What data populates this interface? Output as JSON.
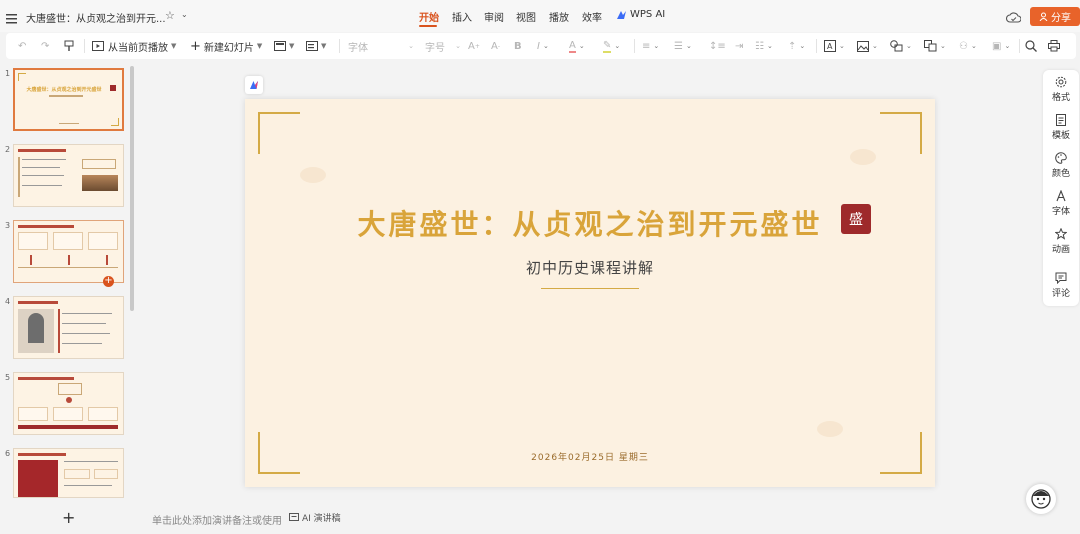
{
  "app": {
    "doc_title": "大唐盛世：从贞观之治到开元...",
    "share_label": "分享"
  },
  "menu": {
    "tabs": [
      "开始",
      "插入",
      "审阅",
      "视图",
      "播放",
      "效率",
      "WPS AI"
    ],
    "active": "开始"
  },
  "toolbar": {
    "play_from_current": "从当前页播放",
    "new_slide": "新建幻灯片",
    "font_placeholder": "字体",
    "size_placeholder": "字号"
  },
  "thumbnails": [
    {
      "num": "1",
      "title": "大唐盛世：从贞观之治到开元盛世"
    },
    {
      "num": "2"
    },
    {
      "num": "3"
    },
    {
      "num": "4"
    },
    {
      "num": "5"
    },
    {
      "num": "6"
    }
  ],
  "slide": {
    "title": "大唐盛世：从贞观之治到开元盛世",
    "seal": "盛",
    "subtitle": "初中历史课程讲解",
    "date": "2026年02月25日 星期三"
  },
  "right_panel": [
    "格式",
    "模板",
    "颜色",
    "字体",
    "动画",
    "评论"
  ],
  "notes": {
    "placeholder": "单击此处添加演讲备注或使用",
    "ai_label": "AI 演讲稿"
  },
  "colors": {
    "accent": "#e8632a",
    "title_gold": "#d9a43a",
    "slide_bg": "#fcf1e1",
    "seal_red": "#9e2a2b"
  }
}
